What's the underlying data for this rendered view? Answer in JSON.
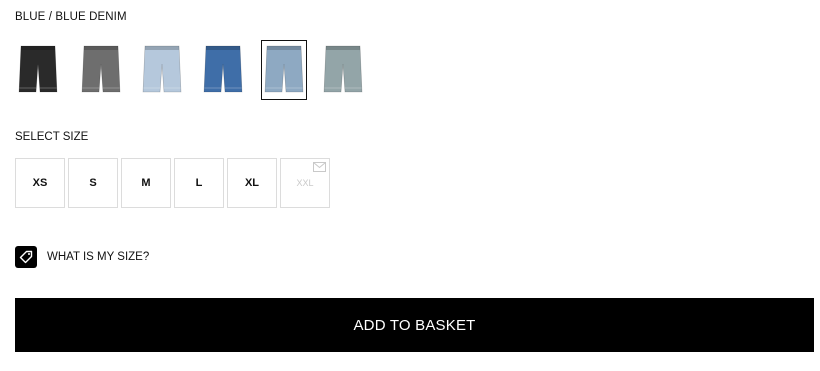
{
  "color": {
    "label": "BLUE / BLUE DENIM",
    "swatches": [
      {
        "name": "black denim shorts",
        "color": "#2a2a2a",
        "selected": false
      },
      {
        "name": "grey denim shorts",
        "color": "#6e6e6e",
        "selected": false
      },
      {
        "name": "light blue denim shorts",
        "color": "#b5c8dc",
        "selected": false
      },
      {
        "name": "mid blue denim shorts",
        "color": "#3f6ea8",
        "selected": false
      },
      {
        "name": "blue denim shorts",
        "color": "#8ea9c2",
        "selected": true
      },
      {
        "name": "washed blue-grey denim shorts",
        "color": "#93a5a8",
        "selected": false
      }
    ]
  },
  "size": {
    "label": "SELECT SIZE",
    "options": [
      {
        "label": "XS",
        "available": true
      },
      {
        "label": "S",
        "available": true
      },
      {
        "label": "M",
        "available": true
      },
      {
        "label": "L",
        "available": true
      },
      {
        "label": "XL",
        "available": true
      },
      {
        "label": "XXL",
        "available": false
      }
    ]
  },
  "size_guide": {
    "label": "WHAT IS MY SIZE?",
    "icon": "tag-icon"
  },
  "cta": {
    "label": "ADD TO BASKET"
  }
}
